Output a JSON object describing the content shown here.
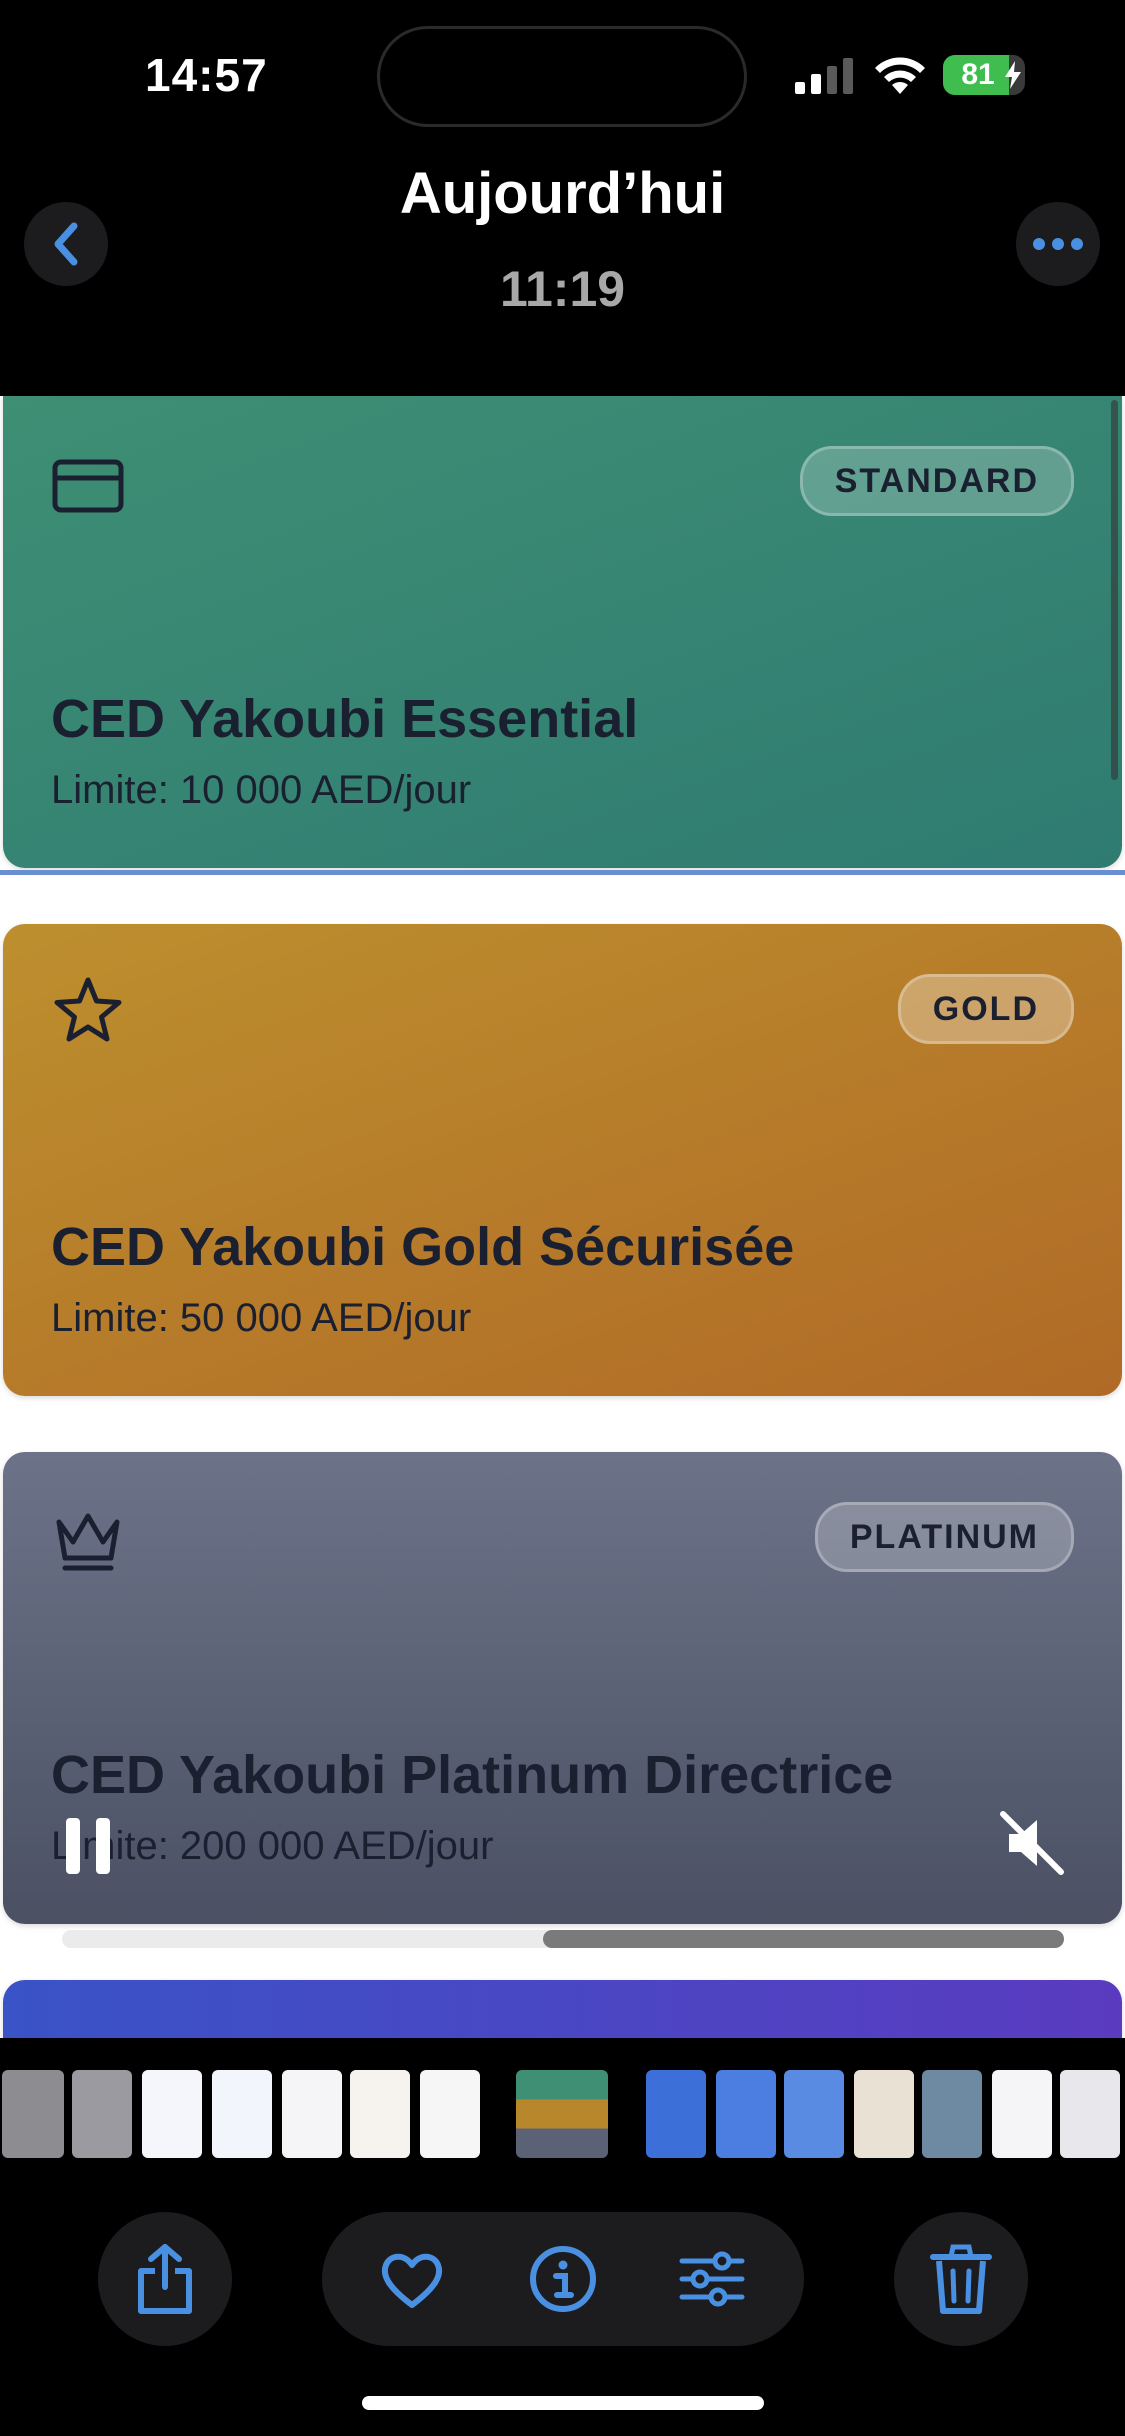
{
  "status_bar": {
    "time": "14:57",
    "battery": "81",
    "battery_level": 0.81
  },
  "header": {
    "title": "Aujourd’hui",
    "subtitle": "11:19"
  },
  "cards": [
    {
      "tier": "STANDARD",
      "name": "CED Yakoubi Essential",
      "limit": "Limite: 10 000 AED/jour",
      "icon": "credit-card-icon",
      "color": "#3e8f74"
    },
    {
      "tier": "GOLD",
      "name": "CED Yakoubi Gold Sécurisée",
      "limit": "Limite: 50 000 AED/jour",
      "icon": "star-icon",
      "color": "#bd8f2e"
    },
    {
      "tier": "PLATINUM",
      "name": "CED Yakoubi Platinum Directrice",
      "limit": "Limite: 200 000 AED/jour",
      "icon": "crown-icon",
      "color": "#6c7389"
    }
  ],
  "video": {
    "progress": 0.52,
    "state": "playing",
    "muted": true
  },
  "toolbar": {
    "accent": "#4a90e2",
    "buttons": [
      "share-icon",
      "heart-icon",
      "info-icon",
      "adjust-icon",
      "trash-icon"
    ]
  }
}
